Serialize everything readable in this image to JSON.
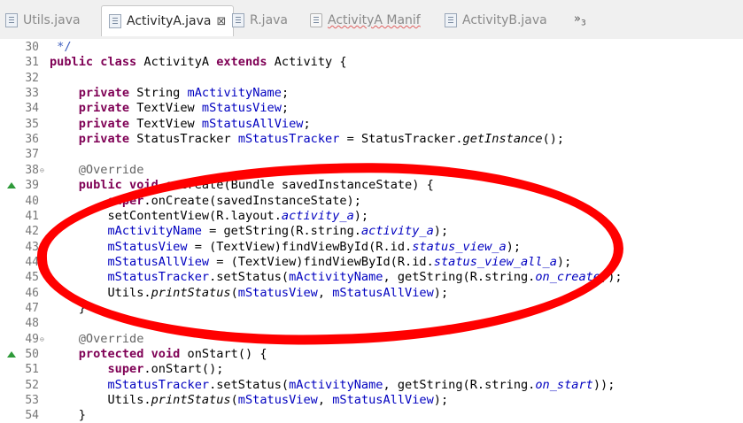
{
  "tabs": [
    {
      "label": "Utils.java",
      "icon": "java-file-icon",
      "active": false
    },
    {
      "label": "ActivityA.java",
      "icon": "java-file-icon",
      "active": true,
      "close": "⊠"
    },
    {
      "label": "R.java",
      "icon": "java-file-icon",
      "active": false
    },
    {
      "label": "ActivityA Manif",
      "icon": "xml-file-icon",
      "active": false
    },
    {
      "label": "ActivityB.java",
      "icon": "java-file-icon",
      "active": false
    }
  ],
  "overflow": {
    "label": "»",
    "count": "3"
  },
  "lines": [
    {
      "num": "30",
      "text": " */"
    },
    {
      "num": "31",
      "text": "public class ActivityA extends Activity {"
    },
    {
      "num": "32",
      "text": ""
    },
    {
      "num": "33",
      "text": "    private String mActivityName;"
    },
    {
      "num": "34",
      "text": "    private TextView mStatusView;"
    },
    {
      "num": "35",
      "text": "    private TextView mStatusAllView;"
    },
    {
      "num": "36",
      "text": "    private StatusTracker mStatusTracker = StatusTracker.getInstance();"
    },
    {
      "num": "37",
      "text": ""
    },
    {
      "num": "38",
      "text": "    @Override"
    },
    {
      "num": "39",
      "text": "    public void onCreate(Bundle savedInstanceState) {"
    },
    {
      "num": "40",
      "text": "        super.onCreate(savedInstanceState);"
    },
    {
      "num": "41",
      "text": "        setContentView(R.layout.activity_a);"
    },
    {
      "num": "42",
      "text": "        mActivityName = getString(R.string.activity_a);"
    },
    {
      "num": "43",
      "text": "        mStatusView = (TextView)findViewById(R.id.status_view_a);"
    },
    {
      "num": "44",
      "text": "        mStatusAllView = (TextView)findViewById(R.id.status_view_all_a);"
    },
    {
      "num": "45",
      "text": "        mStatusTracker.setStatus(mActivityName, getString(R.string.on_create));"
    },
    {
      "num": "46",
      "text": "        Utils.printStatus(mStatusView, mStatusAllView);"
    },
    {
      "num": "47",
      "text": "    }"
    },
    {
      "num": "48",
      "text": ""
    },
    {
      "num": "49",
      "text": "    @Override"
    },
    {
      "num": "50",
      "text": "    protected void onStart() {"
    },
    {
      "num": "51",
      "text": "        super.onStart();"
    },
    {
      "num": "52",
      "text": "        mStatusTracker.setStatus(mActivityName, getString(R.string.on_start));"
    },
    {
      "num": "53",
      "text": "        Utils.printStatus(mStatusView, mStatusAllView);"
    },
    {
      "num": "54",
      "text": "    }"
    }
  ],
  "colors": {
    "keyword": "#7f0055",
    "field": "#0000c0",
    "annotation": "#646464",
    "highlight_circle": "#ff0000",
    "override_marker": "#2e9a3a"
  }
}
